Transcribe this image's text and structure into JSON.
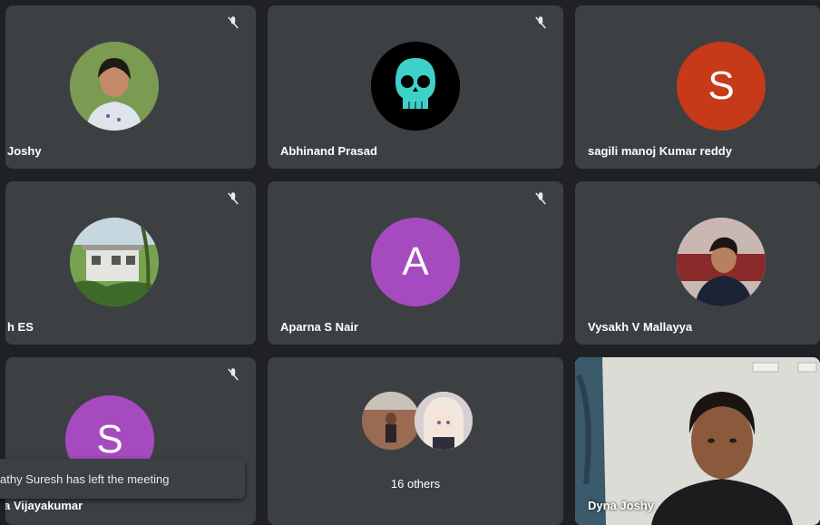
{
  "tiles": [
    {
      "id": "t1",
      "name": "Joshy",
      "avatar_type": "photo",
      "muted": true
    },
    {
      "id": "t2",
      "name": "Abhinand Prasad",
      "avatar_type": "skull",
      "muted": true
    },
    {
      "id": "t3",
      "name": "sagili manoj Kumar reddy",
      "avatar_type": "letter",
      "letter": "S",
      "avatar_color": "#c63a1a",
      "muted": false
    },
    {
      "id": "t4",
      "name": "h ES",
      "avatar_type": "photo-house",
      "muted": true
    },
    {
      "id": "t5",
      "name": "Aparna S Nair",
      "avatar_type": "letter",
      "letter": "A",
      "avatar_color": "#a64bbf",
      "muted": true
    },
    {
      "id": "t6",
      "name": "Vysakh V Mallayya",
      "avatar_type": "photo",
      "muted": false
    },
    {
      "id": "t7",
      "name": "a Vijayakumar",
      "avatar_type": "letter",
      "letter": "S",
      "avatar_color": "#a64bbf",
      "muted": true
    },
    {
      "id": "t8",
      "name": "16 others",
      "avatar_type": "group",
      "muted": false
    },
    {
      "id": "t9",
      "name": "Dyna Joshy",
      "avatar_type": "video",
      "muted": false
    }
  ],
  "toast": {
    "text": "athy Suresh has left the meeting"
  },
  "colors": {
    "accent": "#8ab4f8",
    "tile_bg": "#3c4043",
    "bg": "#202124"
  }
}
